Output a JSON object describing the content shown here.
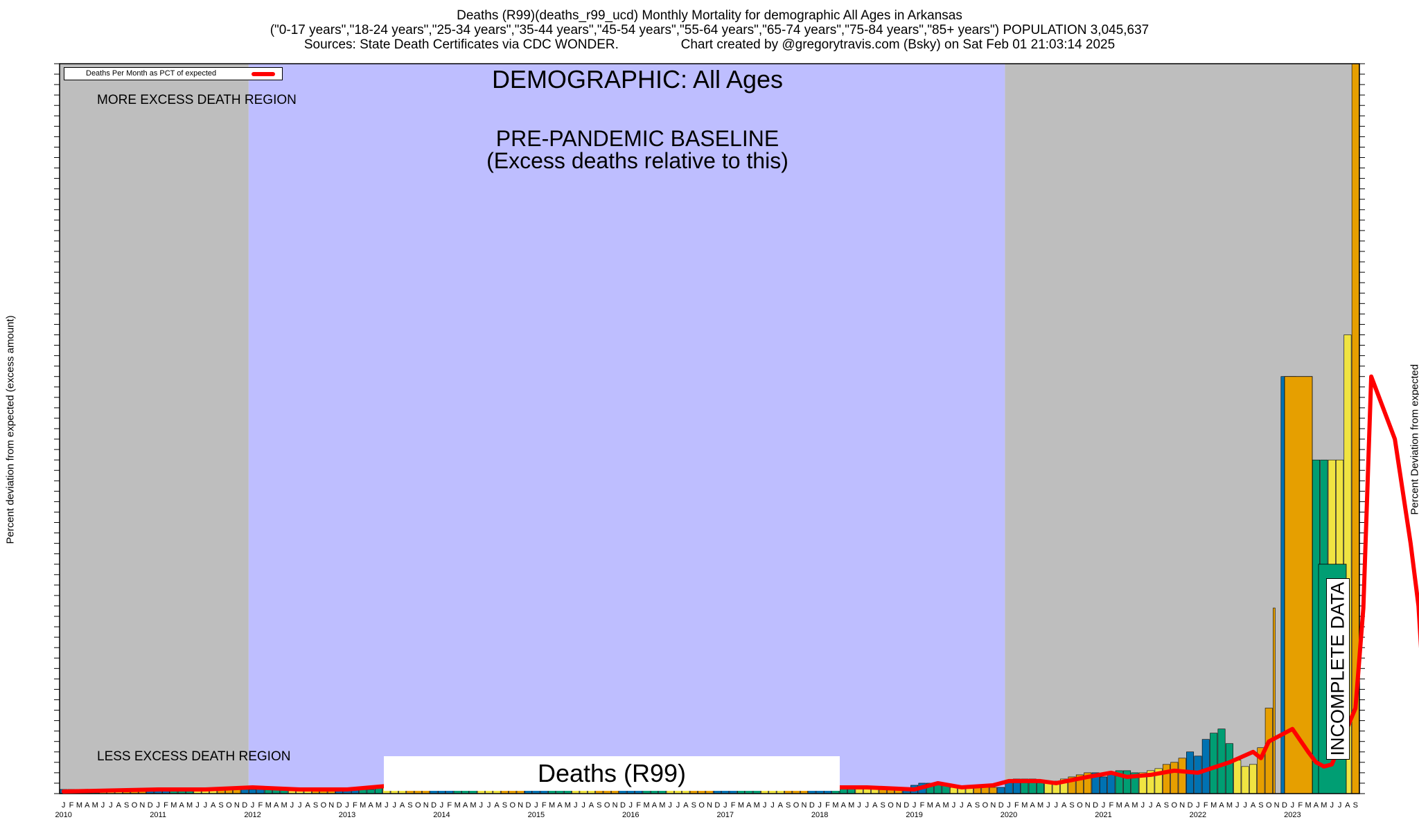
{
  "header": {
    "line1": "Deaths (R99)(deaths_r99_ucd) Monthly Mortality for demographic All Ages in Arkansas",
    "line2": "(\"0-17 years\",\"18-24 years\",\"25-34 years\",\"35-44 years\",\"45-54 years\",\"55-64 years\",\"65-74 years\",\"75-84 years\",\"85+ years\") POPULATION 3,045,637",
    "line3": "Sources: State Death Certificates via CDC WONDER.                 Chart created by @gregorytravis.com (Bsky) on Sat Feb 01 21:03:14 2025"
  },
  "left_axis_label": "Percent deviation from expected (excess amount)",
  "right_axis_label": "Percent Deviation from expected",
  "legend": {
    "label": "Deaths Per Month as PCT of expected",
    "color": "#ff0000"
  },
  "annotations": {
    "demographic": "DEMOGRAPHIC: All Ages",
    "baseline_line1": "PRE-PANDEMIC BASELINE",
    "baseline_line2": "(Excess deaths relative to this)",
    "more_excess": "MORE EXCESS DEATH REGION",
    "less_excess": "LESS EXCESS DEATH REGION",
    "incomplete": "INCOMPLETE DATA",
    "series_box": "Deaths (R99)"
  },
  "colors": {
    "gray_region": "#bebebe",
    "baseline_region": "#bebeff",
    "winter": "#0072b2",
    "spring": "#009e73",
    "summer": "#f0e442",
    "autumn": "#e69f00",
    "line": "#ff0000"
  },
  "chart_data": {
    "type": "bar",
    "x_start": "2010-01",
    "x_end": "2023-07",
    "month_letters": [
      "J",
      "F",
      "M",
      "A",
      "M",
      "J",
      "J",
      "A",
      "S",
      "O",
      "N",
      "D"
    ],
    "years": [
      "2010",
      "2011",
      "2012",
      "2013",
      "2014",
      "2015",
      "2016",
      "2017",
      "2018",
      "2019",
      "2020",
      "2021",
      "2022",
      "2023"
    ],
    "baseline_period": [
      "2012-01",
      "2019-12"
    ],
    "monthly_deaths_pct_of_expected": [
      2,
      2,
      2,
      2,
      1,
      1,
      2,
      2,
      2,
      2,
      2,
      2,
      2,
      2,
      2,
      2,
      2,
      2,
      2,
      2,
      2,
      2,
      2,
      2,
      2,
      3,
      3,
      3,
      3,
      2,
      2,
      2,
      2,
      2,
      2,
      2,
      2,
      2,
      2,
      2,
      3,
      4,
      4,
      4,
      4,
      4,
      4,
      4,
      4,
      4,
      4,
      4,
      4,
      4,
      4,
      4,
      4,
      4,
      4,
      4,
      4,
      4,
      4,
      4,
      4,
      4,
      4,
      4,
      4,
      4,
      4,
      4,
      4,
      4,
      4,
      4,
      4,
      4,
      4,
      4,
      4,
      4,
      4,
      4,
      4,
      4,
      4,
      4,
      4,
      4,
      4,
      4,
      4,
      4,
      4,
      4,
      4,
      4,
      4,
      3,
      3,
      3,
      3,
      3,
      3,
      3,
      2,
      2,
      4,
      5,
      5,
      5,
      4,
      3,
      3,
      3,
      3,
      3,
      3,
      3,
      6,
      7,
      7,
      7,
      6,
      6,
      6,
      7,
      8,
      9,
      10,
      10,
      8,
      10,
      11,
      11,
      10,
      10,
      11,
      12,
      14,
      15,
      17,
      20,
      18,
      26,
      29,
      31,
      24,
      16,
      13,
      14,
      22,
      41,
      89,
      200,
      200,
      160,
      160,
      160,
      160,
      160,
      160,
      220,
      350
    ],
    "trend_line_pct_of_expected": [
      [
        0,
        1
      ],
      [
        6,
        1.5
      ],
      [
        12,
        2
      ],
      [
        18,
        2
      ],
      [
        24,
        3
      ],
      [
        30,
        2
      ],
      [
        36,
        2
      ],
      [
        42,
        4
      ],
      [
        48,
        4
      ],
      [
        60,
        4
      ],
      [
        72,
        4
      ],
      [
        84,
        4
      ],
      [
        96,
        3
      ],
      [
        102,
        3
      ],
      [
        108,
        2
      ],
      [
        111,
        5
      ],
      [
        114,
        3
      ],
      [
        118,
        4
      ],
      [
        120,
        6
      ],
      [
        124,
        6
      ],
      [
        126,
        5
      ],
      [
        130,
        8
      ],
      [
        133,
        10
      ],
      [
        135,
        8
      ],
      [
        138,
        9
      ],
      [
        141,
        11
      ],
      [
        144,
        10
      ],
      [
        148,
        15
      ],
      [
        151,
        20
      ],
      [
        152,
        17
      ],
      [
        153,
        25
      ],
      [
        156,
        31
      ],
      [
        158,
        20
      ],
      [
        159,
        15
      ],
      [
        160,
        13
      ],
      [
        161,
        14
      ],
      [
        164,
        41
      ],
      [
        165,
        89
      ],
      [
        166,
        200
      ],
      [
        169,
        170
      ],
      [
        171,
        120
      ],
      [
        172,
        90
      ],
      [
        173,
        28
      ],
      [
        174,
        26
      ],
      [
        174.5,
        120
      ],
      [
        175,
        350
      ]
    ],
    "ylim": [
      0,
      350
    ],
    "grid": false,
    "legend_position": "top-left"
  }
}
